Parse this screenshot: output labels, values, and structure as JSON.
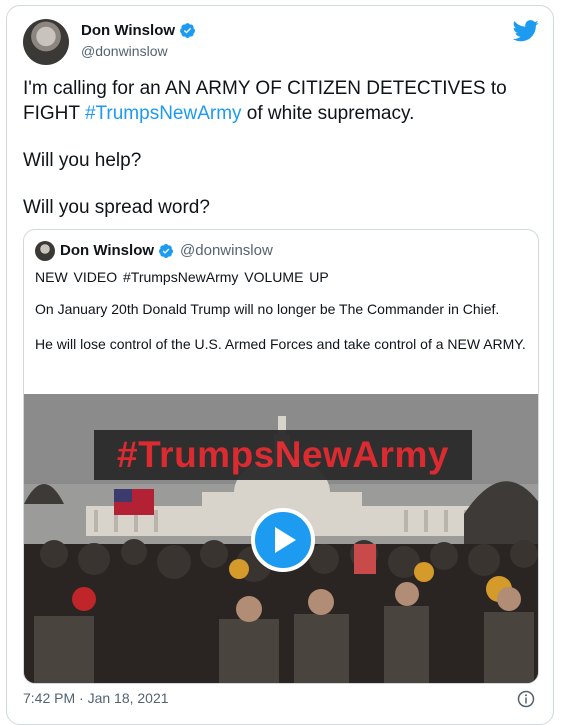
{
  "author": {
    "name": "Don Winslow",
    "handle": "@donwinslow"
  },
  "tweet": {
    "text_before": "I'm calling for an AN ARMY OF CITIZEN DETECTIVES to FIGHT",
    "hashtag": "#TrumpsNewArmy",
    "text_after": " of white supremacy.",
    "line2": "Will you help?",
    "line3": "Will you spread word?"
  },
  "quote": {
    "name": "Don Winslow",
    "handle": "@donwinslow",
    "line1": "NEW VIDEO  #TrumpsNewArmy   VOLUME UP",
    "para1": "On January 20th Donald Trump will no longer be The Commander in Chief.",
    "para2": "He will lose control of the U.S. Armed Forces and take control of a NEW ARMY.",
    "media_banner": "#TrumpsNewArmy"
  },
  "footer": {
    "timestamp": "7:42 PM · Jan 18, 2021"
  },
  "colors": {
    "accent": "#1d9bf0",
    "banner_text": "#e0262c"
  },
  "icons": [
    "verified-icon",
    "twitter-bird-icon",
    "play-icon",
    "info-icon"
  ]
}
